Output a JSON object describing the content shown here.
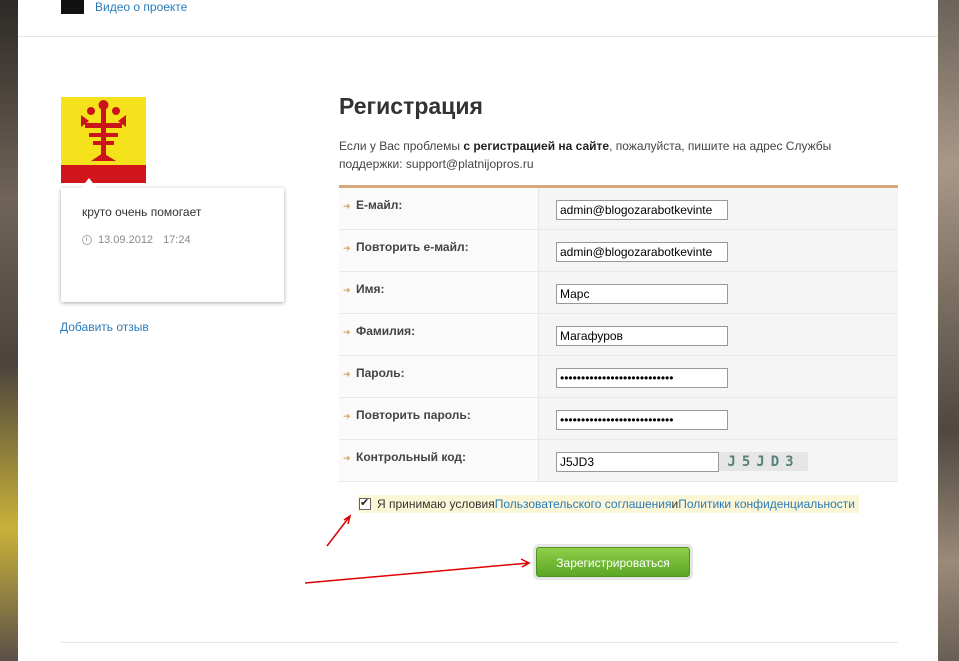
{
  "top": {
    "link": "Видео о проекте"
  },
  "review": {
    "text": "круто очень помогает",
    "date": "13.09.2012",
    "time": "17:24",
    "add_link": "Добавить отзыв"
  },
  "registration": {
    "title": "Регистрация",
    "intro_1": "Если у Вас проблемы ",
    "intro_bold": "с регистрацией на сайте",
    "intro_2": ", пожалуйста, пишите на адрес Службы поддержки: support@platnijopros.ru",
    "fields": [
      {
        "label": "Е-майл:",
        "value": "admin@blogozarabotkevinte"
      },
      {
        "label": "Повторить е-майл:",
        "value": "admin@blogozarabotkevinte"
      },
      {
        "label": "Имя:",
        "value": "Марс"
      },
      {
        "label": "Фамилия:",
        "value": "Магафуров"
      },
      {
        "label": "Пароль:",
        "value": "•••••••••••••••••••••••••••"
      },
      {
        "label": "Повторить пароль:",
        "value": "•••••••••••••••••••••••••••"
      },
      {
        "label": "Контрольный код:",
        "value": "J5JD3",
        "captcha": "J5JD3"
      }
    ],
    "agreement": {
      "checked": true,
      "text_1": "Я принимаю условия ",
      "link_1": "Пользовательского соглашения",
      "text_2": " и ",
      "link_2": "Политики конфиденциальности"
    },
    "submit_label": "Зарегистрироваться"
  },
  "colors": {
    "accent_border": "#d8a978",
    "button_green": "#5aa623",
    "link_blue": "#2a7ab8",
    "annotation_red": "#e00000"
  }
}
